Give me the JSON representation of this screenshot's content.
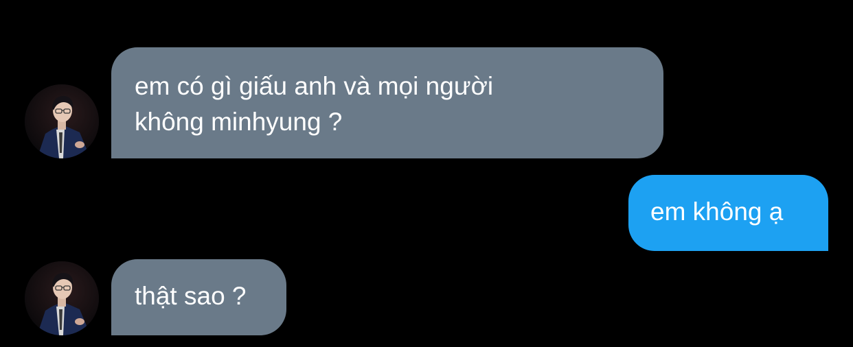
{
  "conversation": {
    "messages": [
      {
        "direction": "incoming",
        "text": "em có gì giấu anh và mọi người\nkhông minhyung ?"
      },
      {
        "direction": "outgoing",
        "text": "em không ạ"
      },
      {
        "direction": "incoming",
        "text": "thật sao ?"
      }
    ],
    "avatar_icon": "profile-photo-icon"
  },
  "colors": {
    "background": "#000000",
    "incoming_bubble": "#6a7a89",
    "outgoing_bubble": "#1da1f2",
    "text": "#ffffff"
  }
}
